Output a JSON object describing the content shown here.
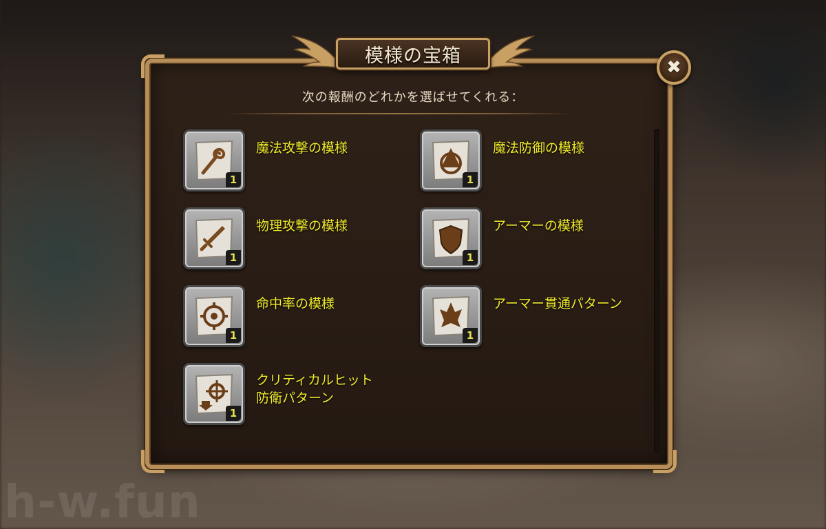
{
  "dialog": {
    "title": "模様の宝箱",
    "subtitle": "次の報酬のどれかを選ばせてくれる："
  },
  "close_button": {
    "glyph": "✖"
  },
  "watermark": "h-w.fun",
  "items": [
    {
      "name": "魔法攻撃の模様",
      "count": "1",
      "icon": "magic-staff-icon"
    },
    {
      "name": "魔法防御の模様",
      "count": "1",
      "icon": "magic-shield-icon"
    },
    {
      "name": "物理攻撃の模様",
      "count": "1",
      "icon": "sword-icon"
    },
    {
      "name": "アーマーの模様",
      "count": "1",
      "icon": "armor-shield-icon"
    },
    {
      "name": "命中率の模様",
      "count": "1",
      "icon": "crosshair-icon"
    },
    {
      "name": "アーマー貫通パターン",
      "count": "1",
      "icon": "armor-pierce-icon"
    },
    {
      "name": "クリティカルヒット\n防衛パターン",
      "count": "1",
      "icon": "critical-defense-icon"
    }
  ],
  "colors": {
    "item_label": "#f0ea2c",
    "frame_gold": "#c9a064",
    "panel_bg": "#2e2118"
  }
}
